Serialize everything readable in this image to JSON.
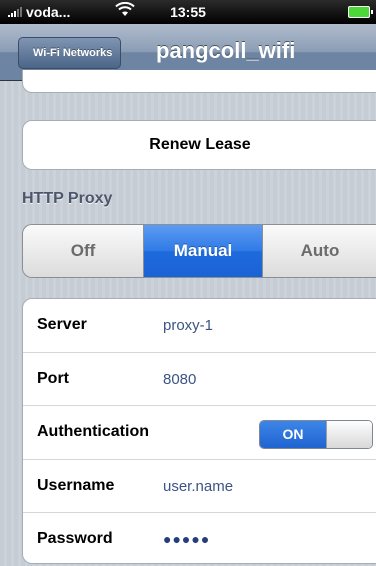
{
  "status_bar": {
    "carrier": "voda...",
    "time": "13:55"
  },
  "nav": {
    "back_label": "Wi-Fi Networks",
    "title": "pangcoll_wifi"
  },
  "renew_label": "Renew Lease",
  "proxy": {
    "header": "HTTP Proxy",
    "options": [
      "Off",
      "Manual",
      "Auto"
    ],
    "selected": "Manual"
  },
  "fields": {
    "server": {
      "label": "Server",
      "value": "proxy-1"
    },
    "port": {
      "label": "Port",
      "value": "8080"
    },
    "authentication": {
      "label": "Authentication",
      "toggle": "ON"
    },
    "username": {
      "label": "Username",
      "value": "user.name"
    },
    "password": {
      "label": "Password",
      "value": "●●●●●"
    }
  }
}
